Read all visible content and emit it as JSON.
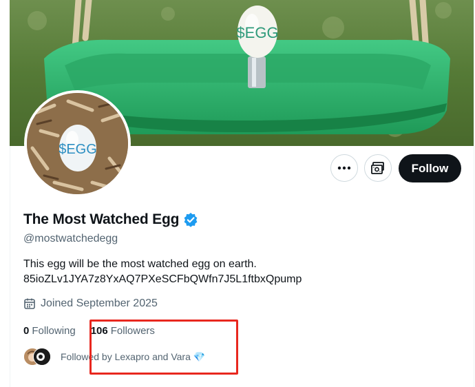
{
  "banner": {
    "image_label": "$EGG",
    "swing_color": "#2fb36a"
  },
  "avatar": {
    "image_label": "$EGG"
  },
  "actions": {
    "more_icon": "ellipsis-icon",
    "subscribe_icon": "subscribe-icon",
    "follow_label": "Follow"
  },
  "profile": {
    "display_name": "The Most Watched Egg",
    "verified_icon": "verified-badge-icon",
    "handle": "@mostwatchedegg",
    "bio_line1": "This egg will be the most watched egg on earth.",
    "bio_line2": "85ioZLv1JYA7z8YxAQ7PXeSCFbQWfn7J5L1ftbxQpump",
    "joined_icon": "calendar-icon",
    "joined": "Joined September 2025"
  },
  "stats": {
    "following_count": "0",
    "following_label": "Following",
    "followers_count": "106",
    "followers_label": "Followers"
  },
  "followed_by": {
    "text": "Followed by Lexapro and Vara",
    "emoji": "💎"
  },
  "colors": {
    "accent_blue": "#1d9bf0",
    "highlight_red": "#e8271e",
    "text_primary": "#0f1419",
    "text_secondary": "#536471"
  }
}
